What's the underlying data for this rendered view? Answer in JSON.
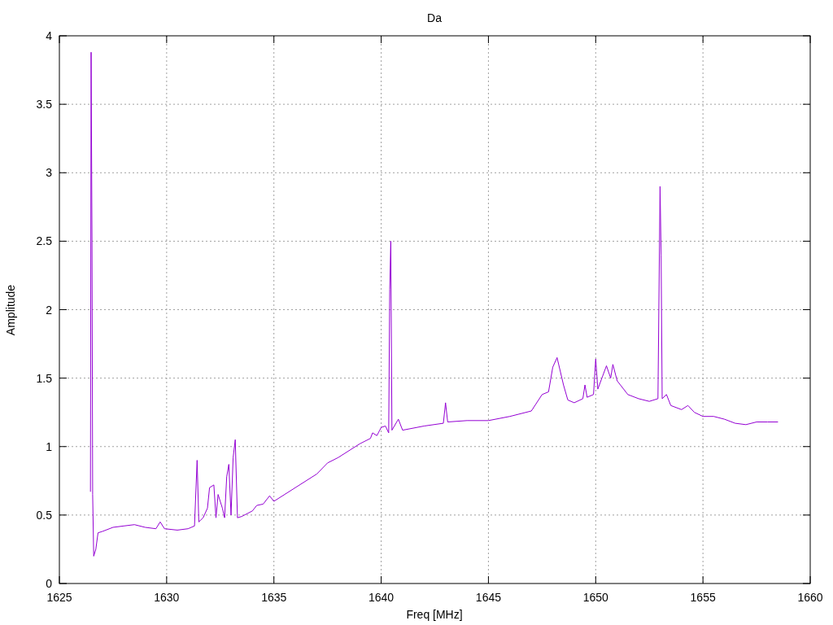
{
  "chart_data": {
    "type": "line",
    "grid": true,
    "title": "Da",
    "xlabel": "Freq [MHz]",
    "ylabel": "Amplitude",
    "xlim": [
      1625,
      1660
    ],
    "ylim": [
      0,
      4
    ],
    "xticks": [
      1625,
      1630,
      1635,
      1640,
      1645,
      1650,
      1655,
      1660
    ],
    "yticks": [
      0,
      0.5,
      1,
      1.5,
      2,
      2.5,
      3,
      3.5,
      4
    ],
    "x": [
      1626.45,
      1626.48,
      1626.52,
      1626.55,
      1626.6,
      1626.7,
      1626.8,
      1627,
      1627.5,
      1628,
      1628.5,
      1629,
      1629.5,
      1629.7,
      1629.9,
      1630.5,
      1631,
      1631.3,
      1631.42,
      1631.5,
      1631.7,
      1631.9,
      1632,
      1632.2,
      1632.3,
      1632.4,
      1632.6,
      1632.7,
      1632.8,
      1632.9,
      1633,
      1633.1,
      1633.2,
      1633.3,
      1633.5,
      1634,
      1634.2,
      1634.5,
      1634.8,
      1635,
      1636,
      1637,
      1637.5,
      1638,
      1639,
      1639.5,
      1639.6,
      1639.8,
      1640,
      1640.2,
      1640.35,
      1640.4,
      1640.45,
      1640.5,
      1640.8,
      1641,
      1642,
      1642.9,
      1643,
      1643.1,
      1644,
      1645,
      1646,
      1647,
      1647.5,
      1647.8,
      1648,
      1648.2,
      1648.5,
      1648.7,
      1649,
      1649.4,
      1649.5,
      1649.6,
      1649.9,
      1650,
      1650.1,
      1650.5,
      1650.7,
      1650.8,
      1651,
      1651.5,
      1652,
      1652.5,
      1652.9,
      1653,
      1653.05,
      1653.1,
      1653.3,
      1653.5,
      1654,
      1654.3,
      1654.6,
      1655,
      1655.5,
      1656,
      1656.5,
      1657,
      1657.5,
      1658,
      1658.5
    ],
    "series": [
      {
        "color": "#9400d3",
        "values": [
          0.67,
          3.88,
          2.5,
          0.65,
          0.2,
          0.25,
          0.37,
          0.38,
          0.41,
          0.42,
          0.43,
          0.41,
          0.4,
          0.45,
          0.4,
          0.39,
          0.4,
          0.42,
          0.9,
          0.45,
          0.48,
          0.55,
          0.7,
          0.72,
          0.48,
          0.65,
          0.55,
          0.48,
          0.78,
          0.87,
          0.5,
          0.92,
          1.05,
          0.48,
          0.49,
          0.53,
          0.57,
          0.58,
          0.64,
          0.6,
          0.7,
          0.8,
          0.88,
          0.92,
          1.02,
          1.06,
          1.1,
          1.08,
          1.14,
          1.15,
          1.1,
          2.15,
          2.5,
          1.12,
          1.2,
          1.12,
          1.15,
          1.17,
          1.32,
          1.18,
          1.19,
          1.19,
          1.22,
          1.26,
          1.38,
          1.4,
          1.58,
          1.65,
          1.45,
          1.34,
          1.32,
          1.35,
          1.45,
          1.36,
          1.38,
          1.64,
          1.42,
          1.59,
          1.5,
          1.6,
          1.48,
          1.38,
          1.35,
          1.33,
          1.35,
          2.9,
          2.4,
          1.35,
          1.38,
          1.3,
          1.27,
          1.3,
          1.25,
          1.22,
          1.22,
          1.2,
          1.17,
          1.16,
          1.18,
          1.18,
          1.18
        ]
      }
    ]
  }
}
